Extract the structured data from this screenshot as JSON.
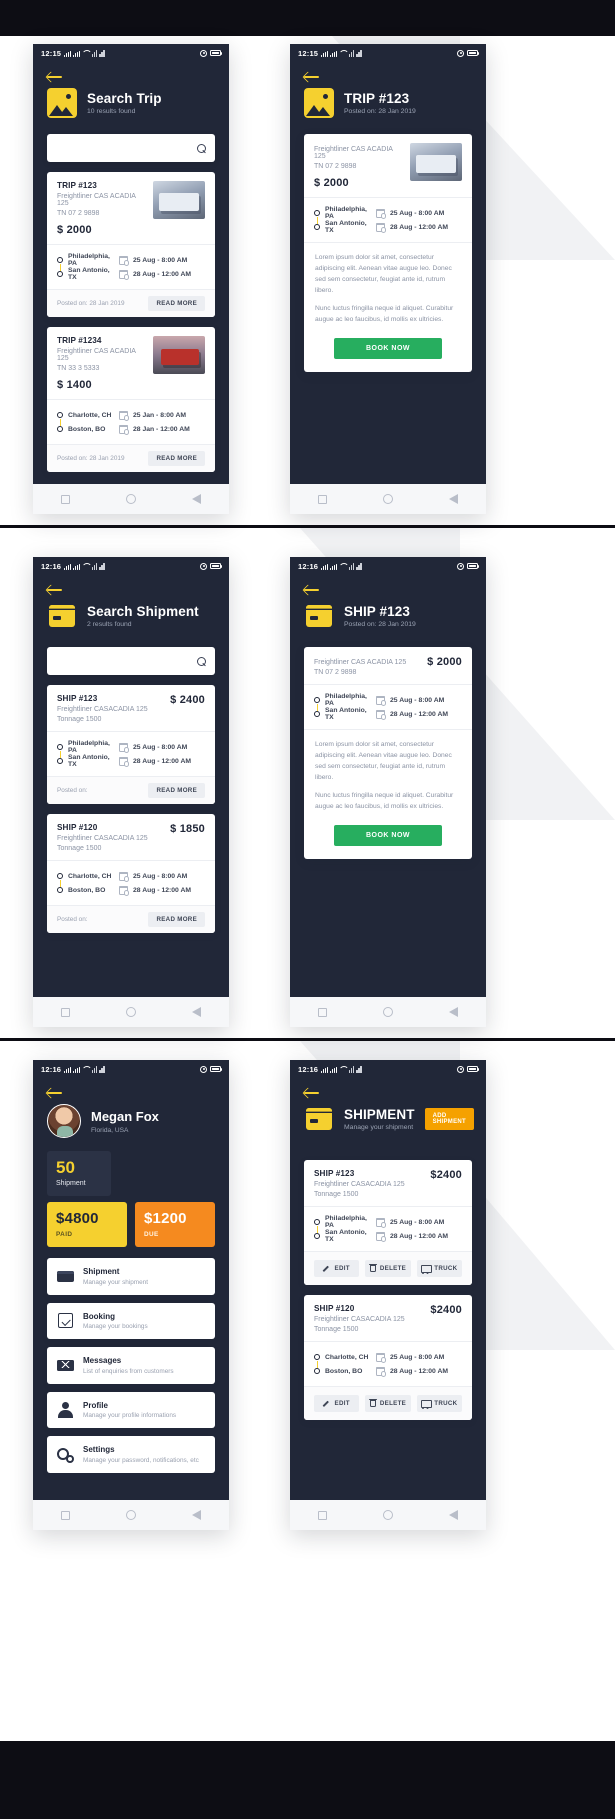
{
  "meta": {
    "status_time_1": "12:15",
    "status_time_2": "12:16"
  },
  "screens": [
    {
      "id": "search-trip",
      "time": "12:15",
      "header": {
        "icon": "map-pin-icon",
        "title": "Search Trip",
        "subtitle": "10 results found"
      },
      "search": {
        "placeholder": "",
        "value": "",
        "icon": "search-icon"
      },
      "cards": [
        {
          "title": "TRIP #123",
          "subtitle": "Freightliner CAS ACADIA 125",
          "plate": "TN 07 2 9898",
          "price": "$ 2000",
          "origin": "Philadelphia, PA",
          "destination": "San Antonio, TX",
          "depart": "25 Aug - 8:00 AM",
          "arrive": "28 Aug - 12:00 AM",
          "posted": "Posted on: 28 Jan 2019",
          "action": "READ MORE"
        },
        {
          "title": "TRIP #1234",
          "subtitle": "Freightliner CAS ACADIA 125",
          "plate": "TN 33 3 5333",
          "price": "$ 1400",
          "origin": "Charlotte, CH",
          "destination": "Boston, BO",
          "depart": "25 Jan - 8:00 AM",
          "arrive": "28 Jan - 12:00 AM",
          "posted": "Posted on: 28 Jan 2019",
          "action": "READ MORE"
        }
      ]
    },
    {
      "id": "trip-detail",
      "time": "12:15",
      "header": {
        "icon": "map-pin-icon",
        "title": "TRIP #123",
        "subtitle": "Posted on: 28 Jan 2019"
      },
      "detail": {
        "subtitle": "Freightliner CAS ACADIA 125",
        "plate": "TN 07 2 9898",
        "price": "$ 2000",
        "origin": "Philadelphia, PA",
        "destination": "San Antonio, TX",
        "depart": "25 Aug - 8:00 AM",
        "arrive": "28 Aug - 12:00 AM",
        "body1": "Lorem ipsum dolor sit amet, consectetur adipiscing elit. Aenean vitae augue leo. Donec sed sem consectetur, feugiat ante id, rutrum libero.",
        "body2": "Nunc luctus fringilla neque id aliquet. Curabitur augue ac leo faucibus, id mollis ex ultricies.",
        "cta": "BOOK NOW"
      }
    },
    {
      "id": "search-shipment",
      "time": "12:16",
      "header": {
        "icon": "box-icon",
        "title": "Search Shipment",
        "subtitle": "2 results found"
      },
      "search": {
        "placeholder": "",
        "value": "",
        "icon": "search-icon"
      },
      "cards": [
        {
          "title": "SHIP #123",
          "subtitle": "Freightliner CASACADIA 125",
          "tonnage": "Tonnage 1500",
          "price": "$ 2400",
          "origin": "Philadelphia, PA",
          "destination": "San Antonio, TX",
          "depart": "25 Aug - 8:00 AM",
          "arrive": "28 Aug - 12:00 AM",
          "posted": "Posted on:",
          "action": "READ MORE"
        },
        {
          "title": "SHIP #120",
          "subtitle": "Freightliner CASACADIA 125",
          "tonnage": "Tonnage 1500",
          "price": "$ 1850",
          "origin": "Charlotte, CH",
          "destination": "Boston, BO",
          "depart": "25 Aug - 8:00 AM",
          "arrive": "28 Aug - 12:00 AM",
          "posted": "Posted on:",
          "action": "READ MORE"
        }
      ]
    },
    {
      "id": "ship-detail",
      "time": "12:16",
      "header": {
        "icon": "box-icon",
        "title": "SHIP #123",
        "subtitle": "Posted on: 28 Jan 2019"
      },
      "detail": {
        "subtitle": "Freightliner CAS ACADIA 125",
        "plate": "TN 07 2 9898",
        "price": "$ 2000",
        "origin": "Philadelphia, PA",
        "destination": "San Antonio, TX",
        "depart": "25 Aug - 8:00 AM",
        "arrive": "28 Aug - 12:00 AM",
        "body1": "Lorem ipsum dolor sit amet, consectetur adipiscing elit. Aenean vitae augue leo. Donec sed sem consectetur, feugiat ante id, rutrum libero.",
        "body2": "Nunc luctus fringilla neque id aliquet. Curabitur augue ac leo faucibus, id mollis ex ultricies.",
        "cta": "BOOK NOW"
      }
    },
    {
      "id": "profile",
      "time": "12:16",
      "user": {
        "name": "Megan Fox",
        "location": "Florida, USA"
      },
      "stat": {
        "value": "50",
        "label": "Shipment"
      },
      "money": [
        {
          "amount": "$4800",
          "label": "PAID"
        },
        {
          "amount": "$1200",
          "label": "DUE"
        }
      ],
      "menu": [
        {
          "icon": "shipment-icon",
          "title": "Shipment",
          "subtitle": "Manage your shipment"
        },
        {
          "icon": "booking-icon",
          "title": "Booking",
          "subtitle": "Manage your bookings"
        },
        {
          "icon": "messages-icon",
          "title": "Messages",
          "subtitle": "List of enquiries from customers"
        },
        {
          "icon": "profile-icon",
          "title": "Profile",
          "subtitle": "Manage your profile informations"
        },
        {
          "icon": "settings-icon",
          "title": "Settings",
          "subtitle": "Manage your password, notifications, etc"
        }
      ]
    },
    {
      "id": "shipment-manage",
      "time": "12:16",
      "header": {
        "icon": "box-icon",
        "title": "SHIPMENT",
        "subtitle": "Manage your shipment",
        "action": "ADD SHIPMENT"
      },
      "cards": [
        {
          "title": "SHIP #123",
          "subtitle": "Freightliner CASACADIA 125",
          "tonnage": "Tonnage 1500",
          "price": "$2400",
          "origin": "Philadelphia, PA",
          "destination": "San Antonio, TX",
          "depart": "25 Aug - 8:00 AM",
          "arrive": "28 Aug - 12:00 AM",
          "actions": [
            "EDIT",
            "DELETE",
            "TRUCK"
          ]
        },
        {
          "title": "SHIP #120",
          "subtitle": "Freightliner CASACADIA 125",
          "tonnage": "Tonnage 1500",
          "price": "$2400",
          "origin": "Charlotte, CH",
          "destination": "Boston, BO",
          "depart": "25 Aug - 8:00 AM",
          "arrive": "28 Aug - 12:00 AM",
          "actions": [
            "EDIT",
            "DELETE",
            "TRUCK"
          ]
        }
      ]
    }
  ],
  "colors": {
    "dark": "#212738",
    "yellow": "#f5d02f",
    "orange": "#f58a1f",
    "green": "#27ae5f",
    "amber": "#f5a100"
  }
}
